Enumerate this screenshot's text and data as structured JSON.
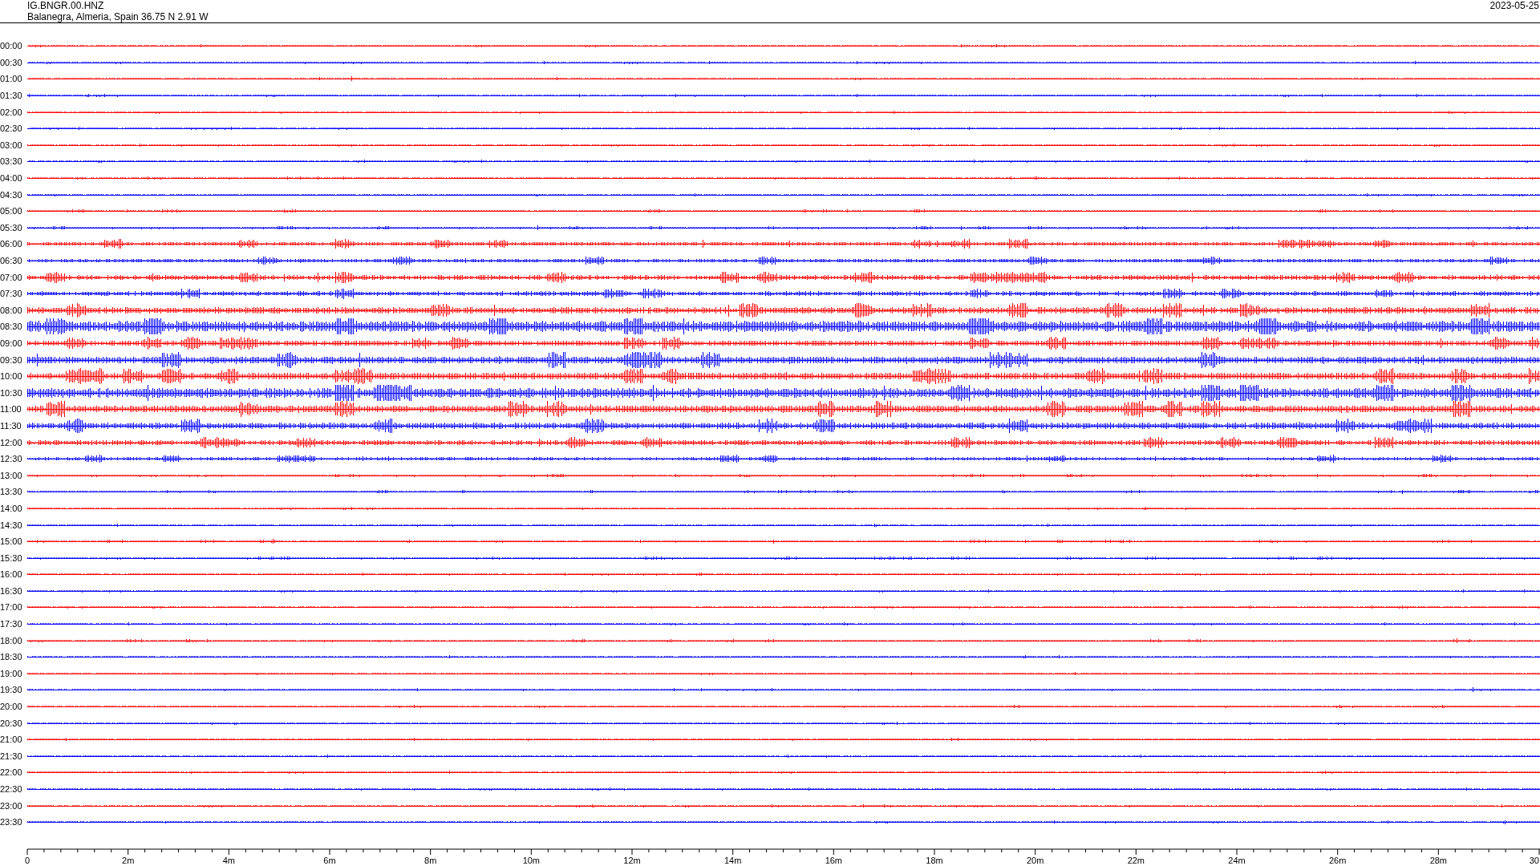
{
  "header": {
    "station": "IG.BNGR.00.HNZ",
    "location": "Balanegra, Almeria, Spain  36.75 N 2.91 W",
    "date": "2023-05-25"
  },
  "traces": [
    {
      "time": "00:00",
      "color": "#ff0000"
    },
    {
      "time": "00:30",
      "color": "#0000ff"
    },
    {
      "time": "01:00",
      "color": "#ff0000"
    },
    {
      "time": "01:30",
      "color": "#0000ff"
    },
    {
      "time": "02:00",
      "color": "#ff0000"
    },
    {
      "time": "02:30",
      "color": "#0000ff"
    },
    {
      "time": "03:00",
      "color": "#ff0000"
    },
    {
      "time": "03:30",
      "color": "#0000ff"
    },
    {
      "time": "04:00",
      "color": "#ff0000"
    },
    {
      "time": "04:30",
      "color": "#0000ff"
    },
    {
      "time": "05:00",
      "color": "#ff0000"
    },
    {
      "time": "05:30",
      "color": "#0000ff"
    },
    {
      "time": "06:00",
      "color": "#ff0000"
    },
    {
      "time": "06:30",
      "color": "#0000ff"
    },
    {
      "time": "07:00",
      "color": "#ff0000"
    },
    {
      "time": "07:30",
      "color": "#0000ff"
    },
    {
      "time": "08:00",
      "color": "#ff0000"
    },
    {
      "time": "08:30",
      "color": "#0000ff"
    },
    {
      "time": "09:00",
      "color": "#ff0000"
    },
    {
      "time": "09:30",
      "color": "#0000ff"
    },
    {
      "time": "10:00",
      "color": "#ff0000"
    },
    {
      "time": "10:30",
      "color": "#0000ff"
    },
    {
      "time": "11:00",
      "color": "#ff0000"
    },
    {
      "time": "11:30",
      "color": "#0000ff"
    },
    {
      "time": "12:00",
      "color": "#ff0000"
    },
    {
      "time": "12:30",
      "color": "#0000ff"
    },
    {
      "time": "13:00",
      "color": "#ff0000"
    },
    {
      "time": "13:30",
      "color": "#0000ff"
    },
    {
      "time": "14:00",
      "color": "#ff0000"
    },
    {
      "time": "14:30",
      "color": "#0000ff"
    },
    {
      "time": "15:00",
      "color": "#ff0000"
    },
    {
      "time": "15:30",
      "color": "#0000ff"
    },
    {
      "time": "16:00",
      "color": "#ff0000"
    },
    {
      "time": "16:30",
      "color": "#0000ff"
    },
    {
      "time": "17:00",
      "color": "#ff0000"
    },
    {
      "time": "17:30",
      "color": "#0000ff"
    },
    {
      "time": "18:00",
      "color": "#ff0000"
    },
    {
      "time": "18:30",
      "color": "#0000ff"
    },
    {
      "time": "19:00",
      "color": "#ff0000"
    },
    {
      "time": "19:30",
      "color": "#0000ff"
    },
    {
      "time": "20:00",
      "color": "#ff0000"
    },
    {
      "time": "20:30",
      "color": "#0000ff"
    },
    {
      "time": "21:00",
      "color": "#ff0000"
    },
    {
      "time": "21:30",
      "color": "#0000ff"
    },
    {
      "time": "22:00",
      "color": "#ff0000"
    },
    {
      "time": "22:30",
      "color": "#0000ff"
    },
    {
      "time": "23:00",
      "color": "#ff0000"
    },
    {
      "time": "23:30",
      "color": "#0000ff"
    }
  ],
  "axis": {
    "tick_labels": [
      "0",
      "2m",
      "4m",
      "6m",
      "8m",
      "10m",
      "12m",
      "14m",
      "16m",
      "18m",
      "20m",
      "22m",
      "24m",
      "26m",
      "28m",
      "30"
    ]
  }
}
